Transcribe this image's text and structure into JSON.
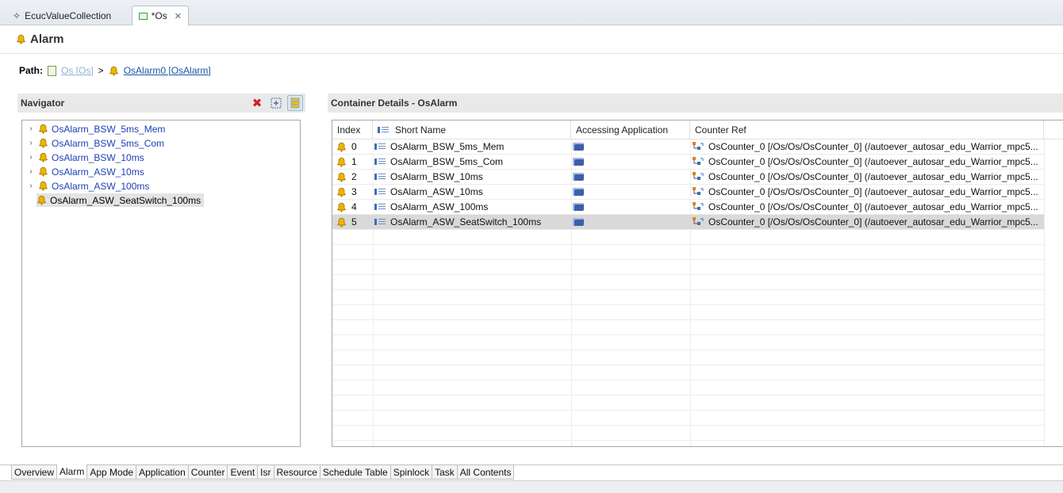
{
  "editor_tabs": [
    {
      "label": "EcucValueCollection",
      "icon": "sparkle-icon"
    },
    {
      "label": "*Os",
      "icon": "os-module-icon",
      "close": "✕"
    }
  ],
  "header": {
    "title": "Alarm",
    "path_label": "Path:",
    "path_separator": ">",
    "path_items": [
      "Os [Os]",
      "OsAlarm0 [OsAlarm]"
    ]
  },
  "navigator": {
    "title": "Navigator",
    "items": [
      {
        "label": "OsAlarm_BSW_5ms_Mem",
        "expandable": true,
        "selected": false
      },
      {
        "label": "OsAlarm_BSW_5ms_Com",
        "expandable": true,
        "selected": false
      },
      {
        "label": "OsAlarm_BSW_10ms",
        "expandable": true,
        "selected": false
      },
      {
        "label": "OsAlarm_ASW_10ms",
        "expandable": true,
        "selected": false
      },
      {
        "label": "OsAlarm_ASW_100ms",
        "expandable": true,
        "selected": false
      },
      {
        "label": "OsAlarm_ASW_SeatSwitch_100ms",
        "expandable": false,
        "selected": true
      }
    ]
  },
  "container_details": {
    "title": "Container Details - OsAlarm",
    "columns": [
      "Index",
      "Short Name",
      "Accessing Application",
      "Counter Ref"
    ],
    "rows": [
      {
        "index": "0",
        "short_name": "OsAlarm_BSW_5ms_Mem",
        "counter_ref": "OsCounter_0 [/Os/Os/OsCounter_0] (/autoever_autosar_edu_Warrior_mpc5..."
      },
      {
        "index": "1",
        "short_name": "OsAlarm_BSW_5ms_Com",
        "counter_ref": "OsCounter_0 [/Os/Os/OsCounter_0] (/autoever_autosar_edu_Warrior_mpc5..."
      },
      {
        "index": "2",
        "short_name": "OsAlarm_BSW_10ms",
        "counter_ref": "OsCounter_0 [/Os/Os/OsCounter_0] (/autoever_autosar_edu_Warrior_mpc5..."
      },
      {
        "index": "3",
        "short_name": "OsAlarm_ASW_10ms",
        "counter_ref": "OsCounter_0 [/Os/Os/OsCounter_0] (/autoever_autosar_edu_Warrior_mpc5..."
      },
      {
        "index": "4",
        "short_name": "OsAlarm_ASW_100ms",
        "counter_ref": "OsCounter_0 [/Os/Os/OsCounter_0] (/autoever_autosar_edu_Warrior_mpc5..."
      },
      {
        "index": "5",
        "short_name": "OsAlarm_ASW_SeatSwitch_100ms",
        "counter_ref": "OsCounter_0 [/Os/Os/OsCounter_0] (/autoever_autosar_edu_Warrior_mpc5..."
      }
    ],
    "selected_row": 5
  },
  "page_tabs": [
    "Overview",
    "Alarm",
    "App Mode",
    "Application",
    "Counter",
    "Event",
    "Isr",
    "Resource",
    "Schedule Table",
    "Spinlock",
    "Task",
    "All Contents"
  ],
  "active_page_tab": "Alarm",
  "colors": {
    "link": "#1c3fb5",
    "selection": "#d9d9d9",
    "bell": "#e0a800"
  }
}
